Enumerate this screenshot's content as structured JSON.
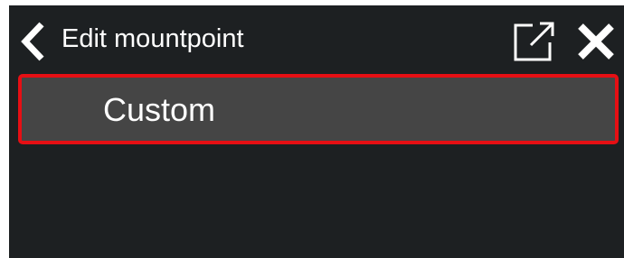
{
  "header": {
    "title": "Edit mountpoint",
    "back_icon": "chevron-left-icon",
    "open_external_icon": "open-external-icon",
    "close_icon": "close-icon"
  },
  "list": {
    "items": [
      {
        "label": "Custom",
        "selected": true
      }
    ]
  },
  "colors": {
    "background": "#1d2022",
    "item_background": "#454545",
    "selection_border": "#e60f14",
    "text": "#ffffff"
  }
}
